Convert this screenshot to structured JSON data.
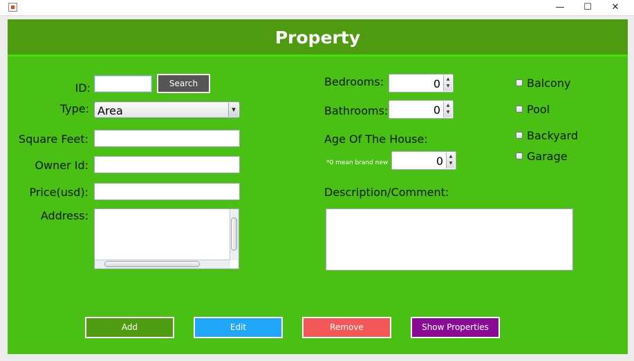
{
  "window": {
    "minimize_glyph": "—",
    "maximize_glyph": "☐",
    "close_glyph": "✕"
  },
  "header": {
    "title": "Property"
  },
  "form": {
    "id": {
      "label": "ID:",
      "value": ""
    },
    "search_button": "Search",
    "type": {
      "label": "Type:",
      "selected": "Area",
      "arrow": "▾"
    },
    "square_feet": {
      "label": "Square Feet:",
      "value": ""
    },
    "owner_id": {
      "label": "Owner Id:",
      "value": ""
    },
    "price": {
      "label": "Price(usd):",
      "value": ""
    },
    "address": {
      "label": "Address:",
      "value": ""
    },
    "bedrooms": {
      "label": "Bedrooms:",
      "value": "0"
    },
    "bathrooms": {
      "label": "Bathrooms:",
      "value": "0"
    },
    "age": {
      "label": "Age Of The House:",
      "hint": "*0 mean brand new",
      "value": "0"
    },
    "description": {
      "label": "Description/Comment:",
      "value": ""
    }
  },
  "features": [
    {
      "label": "Balcony",
      "checked": false
    },
    {
      "label": "Pool",
      "checked": false
    },
    {
      "label": "Backyard",
      "checked": false
    },
    {
      "label": "Garage",
      "checked": false
    }
  ],
  "actions": {
    "add": "Add",
    "edit": "Edit",
    "remove": "Remove",
    "show": "Show Properties"
  },
  "colors": {
    "header": "#4e9a10",
    "panel": "#4ac014",
    "add": "#4e9a10",
    "edit": "#21a5f6",
    "remove": "#f45757",
    "show": "#8a0c94"
  }
}
